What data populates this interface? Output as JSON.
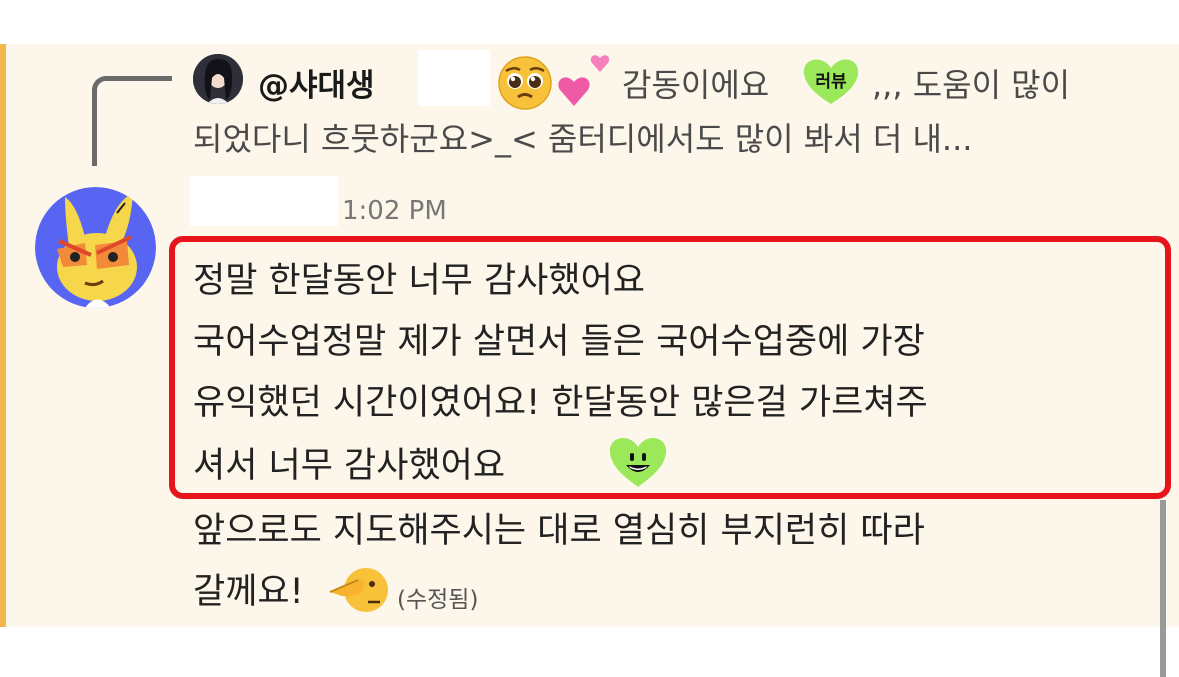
{
  "reply": {
    "author": "@샤대생",
    "text_start": "감동이에요",
    "badge_text": "러뷰",
    "text_end": ",,, 도움이 많이",
    "line2": "되었다니 흐뭇하군요>_<  줌터디에서도 많이 봐서 더 내..."
  },
  "message": {
    "timestamp": "1:02 PM",
    "lines": [
      "정말 한달동안 너무 감사했어요",
      "국어수업정말 제가 살면서 들은 국어수업중에 가장",
      "유익했던 시간이였어요! 한달동안 많은걸 가르쳐주",
      "셔서 너무 감사했어요",
      "앞으로도 지도해주시는 대로 열심히 부지런히 따라",
      "갈께요!"
    ],
    "edited_label": "(수정됨)"
  },
  "colors": {
    "highlight_border": "#e8141c",
    "mention_bar": "#f2b84b",
    "message_bg": "#fdf6ea",
    "heart_green": "#9be85a"
  },
  "icons": {
    "reply_avatar": "user-avatar",
    "author_avatar": "yellow-rabbit-avatar",
    "pleading": "pleading-face-icon",
    "hearts": "two-hearts-icon",
    "green_heart": "green-heart-grin-icon",
    "pointing": "pointing-face-icon"
  }
}
